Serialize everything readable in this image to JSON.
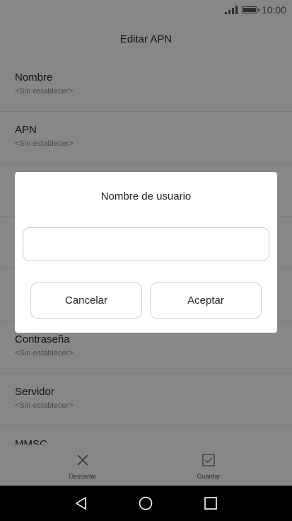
{
  "status_bar": {
    "time": "10:00"
  },
  "header": {
    "title": "Editar APN"
  },
  "list": {
    "items": [
      {
        "label": "Nombre",
        "value": "<Sin establecer>"
      },
      {
        "label": "APN",
        "value": "<Sin establecer>"
      },
      {
        "label": "",
        "value": ""
      },
      {
        "label": "",
        "value": ""
      },
      {
        "label": "",
        "value": ""
      },
      {
        "label": "Contraseña",
        "value": "<Sin establecer>"
      },
      {
        "label": "Servidor",
        "value": "<Sin establecer>"
      },
      {
        "label": "MMSC",
        "value": ""
      }
    ]
  },
  "dialog": {
    "title": "Nombre de usuario",
    "input_value": "",
    "cancel_label": "Cancelar",
    "accept_label": "Aceptar"
  },
  "bottom_actions": {
    "discard": {
      "label": "Descartar",
      "icon": "close-icon"
    },
    "save": {
      "label": "Guardar",
      "icon": "checkbox-icon"
    }
  },
  "nav_bar": {
    "back_icon": "back-icon",
    "home_icon": "home-icon",
    "recents_icon": "recents-icon"
  }
}
